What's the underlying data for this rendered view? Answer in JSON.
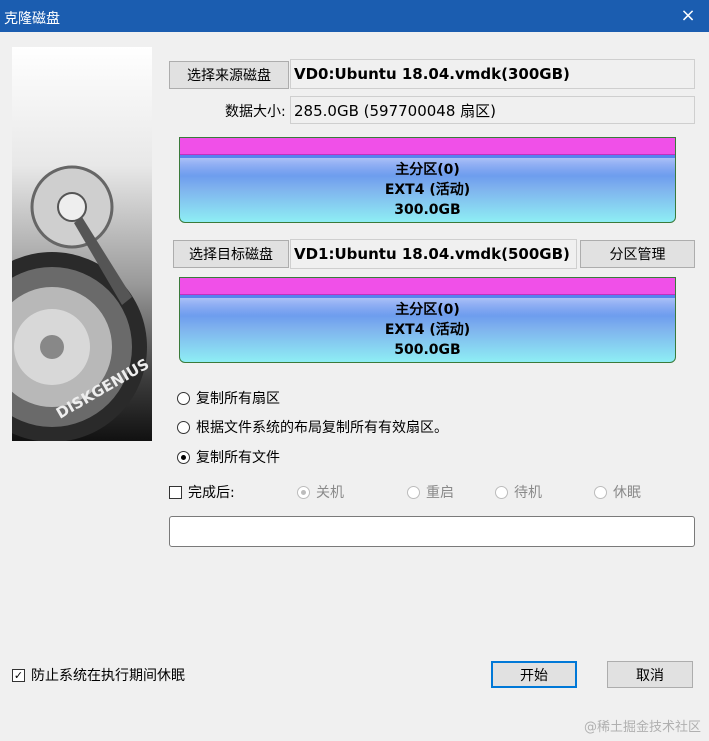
{
  "window": {
    "title": "克隆磁盘",
    "close_icon": "×"
  },
  "source": {
    "select_button": "选择来源磁盘",
    "disk_name": "VD0:Ubuntu 18.04.vmdk(300GB)",
    "size_label": "数据大小:",
    "size_value": "285.0GB (597700048 扇区)",
    "partition": {
      "name": "主分区(0)",
      "fs": "EXT4 (活动)",
      "size": "300.0GB"
    }
  },
  "target": {
    "select_button": "选择目标磁盘",
    "disk_name": "VD1:Ubuntu 18.04.vmdk(500GB)",
    "manage_button": "分区管理",
    "partition": {
      "name": "主分区(0)",
      "fs": "EXT4 (活动)",
      "size": "500.0GB"
    }
  },
  "modes": [
    {
      "label": "复制所有扇区",
      "selected": false
    },
    {
      "label": "根据文件系统的布局复制所有有效扇区。",
      "selected": false
    },
    {
      "label": "复制所有文件",
      "selected": true
    }
  ],
  "after": {
    "label": "完成后:",
    "options": [
      "关机",
      "重启",
      "待机",
      "休眠"
    ]
  },
  "prevent_sleep": "防止系统在执行期间休眠",
  "start_button": "开始",
  "cancel_button": "取消",
  "brand": "DISKGENIUS",
  "watermark": "@稀土掘金技术社区"
}
